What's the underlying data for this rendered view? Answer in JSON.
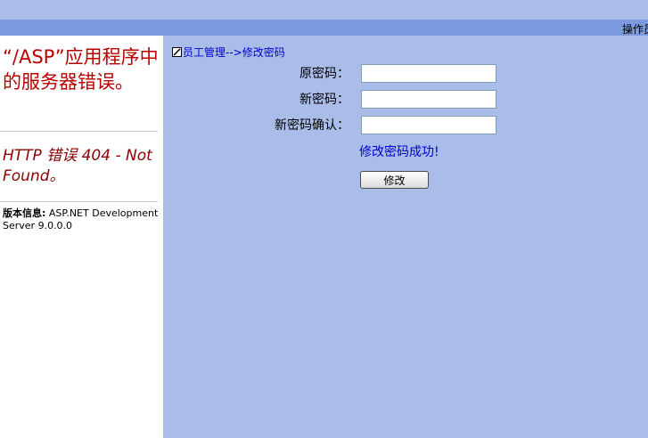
{
  "header": {
    "right_label": "操作员"
  },
  "error_panel": {
    "title": "“/ASP”应用程序中的服务器错误。",
    "code": "HTTP 错误 404 - Not Found。",
    "version_label": "版本信息:",
    "version_value": " ASP.NET Development Server 9.0.0.0"
  },
  "breadcrumb": {
    "text": "员工管理-->修改密码",
    "icon": "edit-icon"
  },
  "form": {
    "old_password_label": "原密码：",
    "new_password_label": "新密码：",
    "confirm_password_label": "新密码确认：",
    "old_password_value": "",
    "new_password_value": "",
    "confirm_password_value": "",
    "success_message": "修改密码成功!",
    "submit_label": "修改"
  }
}
